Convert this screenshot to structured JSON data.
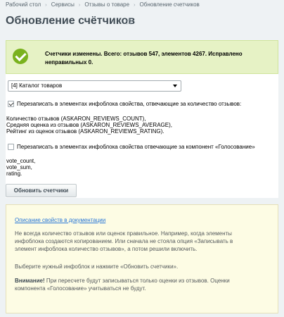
{
  "breadcrumb": [
    "Рабочий стол",
    "Сервисы",
    "Отзывы о товаре",
    "Обновление счетчиков"
  ],
  "page": {
    "title": "Обновление счётчиков"
  },
  "notice": {
    "line1": "Счетчики изменены. Всего: отзывов 547, элементов 4267. Исправлено",
    "line2": "неправильных 0."
  },
  "form": {
    "iblock_select": "[4] Каталог товаров",
    "overwrite_reviews": {
      "checked": true,
      "label": "Перезаписать в элементах инфоблока свойства, отвечающие за количество отзывов:"
    },
    "reviews_props": [
      "Количество отзывов (ASKARON_REVIEWS_COUNT),",
      "Средняя оценка из отзывов (ASKARON_REVIEWS_AVERAGE),",
      "Рейтинг из оценок отзывов (ASKARON_REVIEWS_RATING)."
    ],
    "overwrite_vote": {
      "checked": false,
      "label": "Перезаписать в элементах инфоблока свойства отвечающие за компонент «Голосование»"
    },
    "vote_props": [
      "vote_count,",
      "vote_sum,",
      "rating."
    ],
    "submit_label": "Обновить счетчики"
  },
  "info": {
    "doc_link": "Описание свойств в документации",
    "p1": [
      "Не всегда количество отзывов или оценок правильное. Например, когда элементы",
      "инфоблока создаются копированием. Или сначала не стояла опция «Записывать в",
      "элемент инфоблока количество отзывов», а потом решили включить."
    ],
    "p2": "Выберите нужный инфоблок и нажмите «Обновить счетчики».",
    "p3_bold": "Внимание!",
    "p3_line1": " При пересчете будут записываться только оценки из отзывов. Оценки",
    "p3_line2": "компонента «Голосование» учитываться не будут."
  },
  "colors": {
    "accent_green": "#7ab21e",
    "link": "#2675d7",
    "success_bg": "#e6f2c5",
    "info_bg": "#fdfce4"
  }
}
